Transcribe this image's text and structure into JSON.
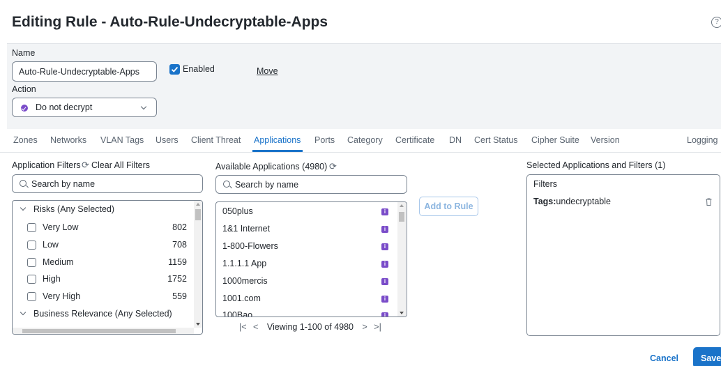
{
  "header": {
    "title": "Editing Rule - Auto-Rule-Undecryptable-Apps",
    "help_icon": "question-circle-icon"
  },
  "form": {
    "name_label": "Name",
    "name_value": "Auto-Rule-Undecryptable-Apps",
    "enabled_label": "Enabled",
    "enabled_checked": true,
    "move_label": "Move",
    "action_label": "Action",
    "action_value": "Do not decrypt"
  },
  "tabs": [
    {
      "label": "Zones"
    },
    {
      "label": "Networks"
    },
    {
      "label": "VLAN Tags"
    },
    {
      "label": "Users"
    },
    {
      "label": "Client Threat"
    },
    {
      "label": "Applications",
      "active": true
    },
    {
      "label": "Ports"
    },
    {
      "label": "Category"
    },
    {
      "label": "Certificate"
    },
    {
      "label": "DN"
    },
    {
      "label": "Cert Status"
    },
    {
      "label": "Cipher Suite"
    },
    {
      "label": "Version"
    },
    {
      "label": "Logging"
    }
  ],
  "filters": {
    "heading": "Application Filters",
    "clear_label": "Clear All Filters",
    "search_placeholder": "Search by name",
    "groups": [
      {
        "label": "Risks (Any Selected)",
        "items": [
          {
            "label": "Very Low",
            "count": "802"
          },
          {
            "label": "Low",
            "count": "708"
          },
          {
            "label": "Medium",
            "count": "1159"
          },
          {
            "label": "High",
            "count": "1752"
          },
          {
            "label": "Very High",
            "count": "559"
          }
        ]
      },
      {
        "label": "Business Relevance (Any Selected)"
      }
    ]
  },
  "available": {
    "heading": "Available Applications (4980)",
    "search_placeholder": "Search by name",
    "items": [
      "050plus",
      "1&1 Internet",
      "1-800-Flowers",
      "1.1.1.1 App",
      "1000mercis",
      "1001.com",
      "100Bao"
    ],
    "pager_text": "Viewing 1-100 of 4980"
  },
  "add_button": "Add to Rule",
  "selected": {
    "heading": "Selected Applications and Filters (1)",
    "filters_label": "Filters",
    "tag_key": "Tags:",
    "tag_value": "undecryptable"
  },
  "footer": {
    "cancel": "Cancel",
    "save": "Save"
  },
  "colors": {
    "accent": "#1a73c9",
    "purple": "#7a4cc9",
    "panel": "#f2f4f6"
  }
}
